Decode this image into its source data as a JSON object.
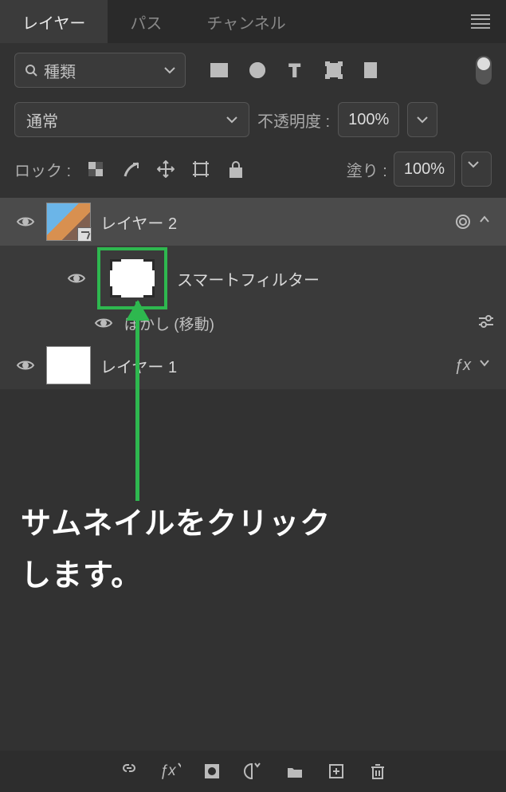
{
  "tabs": {
    "layers": "レイヤー",
    "paths": "パス",
    "channels": "チャンネル"
  },
  "search_label": "種類",
  "blend": {
    "mode": "通常",
    "opacity_label": "不透明度 :",
    "opacity_value": "100%"
  },
  "lock": {
    "label": "ロック :",
    "fill_label": "塗り :",
    "fill_value": "100%"
  },
  "layers": {
    "layer2": "レイヤー 2",
    "smart_filter": "スマートフィルター",
    "blur_motion": "ぼかし (移動)",
    "layer1": "レイヤー 1",
    "fx": "ƒx"
  },
  "annotation_line1": "サムネイルをクリック",
  "annotation_line2": "します。"
}
